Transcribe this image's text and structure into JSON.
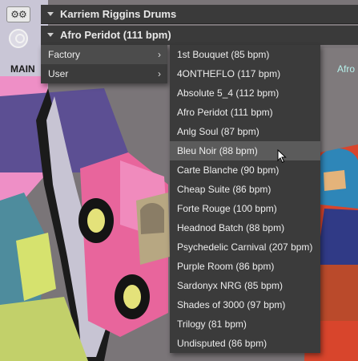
{
  "header": {
    "instrument_title": "Karriem Riggins Drums",
    "snapshot_title": "Afro Peridot (111 bpm)",
    "gear_glyph": "⚙⚙"
  },
  "sidebar": {
    "main_label": "MAIN",
    "right_label": "Afro"
  },
  "category_menu": {
    "items": [
      {
        "label": "Factory",
        "open": true
      },
      {
        "label": "User",
        "open": false
      }
    ],
    "chevron": "›"
  },
  "preset_menu": {
    "highlighted_index": 5,
    "items": [
      "1st Bouquet (85 bpm)",
      "4ONTHEFLO (117 bpm)",
      "Absolute 5_4 (112 bpm)",
      "Afro Peridot (111 bpm)",
      "Anlg Soul (87 bpm)",
      "Bleu Noir (88 bpm)",
      "Carte Blanche (90 bpm)",
      "Cheap Suite (86 bpm)",
      "Forte Rouge (100 bpm)",
      "Headnod Batch (88 bpm)",
      "Psychedelic Carnival (207 bpm)",
      "Purple Room (86 bpm)",
      "Sardonyx NRG (85 bpm)",
      "Shades of 3000 (97 bpm)",
      "Trilogy (81 bpm)",
      "Undisputed (86 bpm)"
    ]
  },
  "colors": {
    "menu_bg": "#3b3b3b",
    "menu_highlight": "#5b5b5b",
    "menu_text": "#ededed",
    "bar_bg": "#3a3a3a"
  }
}
